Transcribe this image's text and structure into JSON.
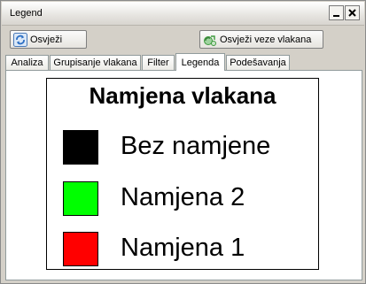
{
  "window": {
    "title": "Legend"
  },
  "toolbar": {
    "refresh_label": "Osvježi",
    "refresh_links_label": "Osvježi veze vlakana"
  },
  "tabs": [
    {
      "label": "Analiza"
    },
    {
      "label": "Grupisanje vlakana"
    },
    {
      "label": "Filter"
    },
    {
      "label": "Legenda",
      "active": true
    },
    {
      "label": "Podešavanja"
    }
  ],
  "legend": {
    "title": "Namjena vlakana",
    "items": [
      {
        "label": "Bez namjene",
        "color": "#000000"
      },
      {
        "label": "Namjena 2",
        "color": "#00ff00"
      },
      {
        "label": "Namjena 1",
        "color": "#ff0000"
      }
    ]
  },
  "colors": {
    "refresh_icon": "#2c6fc4",
    "refresh_links_icon": "#3c9a3c"
  }
}
